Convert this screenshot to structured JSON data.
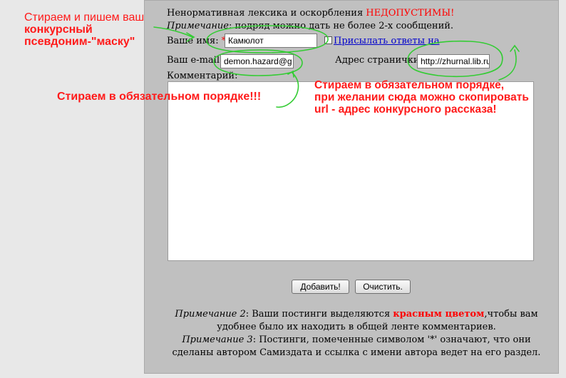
{
  "form": {
    "warning_prefix": "Ненормативная лексика и оскорбления",
    "warning_highlight": "НЕДОПУСТИМЫ!",
    "note_label": "Примечание",
    "note_text": ": подряд можно дать не более 2-х сообщений.",
    "name_label": "Ваше имя:",
    "required_mark": "*",
    "name_value": "Камюлот",
    "subscribe_label": "Присылать ответы на",
    "email_label": "Ваш e-mail:",
    "email_value": "demon.hazard@g",
    "page_label": "Адрес странички:",
    "page_value": "http://zhurnal.lib.ru",
    "comment_label": "Комментарий:",
    "comment_value": "",
    "submit_label": "Добавить!",
    "clear_label": "Очистить."
  },
  "notes": {
    "note2_label": "Примечание 2",
    "note2_text_a": ": Ваши постинги выделяются ",
    "note2_red": "красным цветом",
    "note2_text_b": ",чтобы вам удобнее было их находить в общей ленте комментариев.",
    "note3_label": "Примечание 3",
    "note3_text": ": Постинги, помеченные символом '*' означают, что они сделаны автором Самиздата и ссылка с имени автора ведет на его раздел."
  },
  "annotations": {
    "a1_line1": "Стираем и пишем ваш",
    "a1_line2": "конкурсный",
    "a1_line3": "псевдоним-\"маску\"",
    "a2": "Стираем в обязательном порядке!!!",
    "a3_line1": "Стираем в обязательном порядке,",
    "a3_line2": "при желании сюда можно скопировать",
    "a3_line3": "url - адрес конкурсного рассказа!"
  },
  "colors": {
    "annotation": "#ff1a1a",
    "scribble": "#33cc33",
    "panel": "#c0c0c0"
  }
}
